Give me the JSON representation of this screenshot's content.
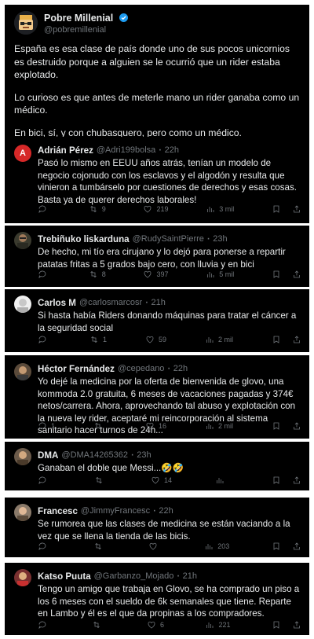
{
  "main_tweet": {
    "name": "Pobre Millenial",
    "handle": "@pobremillenial",
    "paragraphs": [
      "España es esa clase de país donde uno de sus pocos unicornios es destruido porque a alguien se le ocurrió que un rider estaba explotado.",
      "Lo curioso es que antes de meterle mano un rider ganaba como un médico.",
      "En bici, sí,  y con chubasquero, pero como un médico."
    ]
  },
  "replies": [
    {
      "name": "Adrián Pérez",
      "handle": "@Adri199bolsa",
      "time": "22h",
      "avatar_letter": "A",
      "avatar_color": "#d62828",
      "text": "Pasó lo mismo en EEUU años atrás, tenían un modelo de negocio cojonudo con los esclavos y el algodón y resulta que vinieron a tumbárselo por cuestiones de derechos y esas cosas. Basta ya de querer derechos laborales!",
      "replies": "",
      "retweets": "9",
      "likes": "219",
      "views": "3 mil"
    },
    {
      "name": "Trebiñuko liskarduna",
      "handle": "@RudySaintPierre",
      "time": "23h",
      "avatar_letter": "",
      "avatar_color": "#3a3a2e",
      "text": "De hecho, mi tío era cirujano y lo dejó para ponerse a repartir patatas fritas a 5 grados bajo cero, con lluvia y en bici",
      "replies": "",
      "retweets": "8",
      "likes": "397",
      "views": "5 mil"
    },
    {
      "name": "Carlos M",
      "handle": "@carlosmarcosr",
      "time": "21h",
      "avatar_letter": "",
      "avatar_color": "#f0f0f0",
      "text": "Si hasta había Riders donando máquinas para tratar el cáncer a la seguridad social",
      "replies": "",
      "retweets": "1",
      "likes": "59",
      "views": "2 mil"
    },
    {
      "name": "Héctor Fernández",
      "handle": "@cepedano",
      "time": "22h",
      "avatar_letter": "",
      "avatar_color": "#5a4a3a",
      "text": "Yo dejé la medicina por la oferta de bienvenida de glovo, una kommoda 2.0 gratuita, 6 meses de vacaciones pagadas y 374€ netos/carrera. Ahora, aprovechando tal abuso y explotación con la nueva ley rider, aceptaré mi reincorporación al sistema sanitario hacer turnos de 24h...",
      "replies": "1",
      "retweets": "",
      "likes": "16",
      "views": "2 mil"
    },
    {
      "name": "DMA",
      "handle": "@DMA14265362",
      "time": "23h",
      "avatar_letter": "",
      "avatar_color": "#6b5a4a",
      "text": "Ganaban el doble que Messi...🤣🤣",
      "replies": "",
      "retweets": "",
      "likes": "14",
      "views": ""
    },
    {
      "name": "Francesc",
      "handle": "@JimmyFrancesc",
      "time": "22h",
      "avatar_letter": "",
      "avatar_color": "#8a7a6a",
      "text": "Se rumorea que las clases de medicina se están vaciando a la vez que se llena la tienda de las bicis.",
      "replies": "",
      "retweets": "",
      "likes": "",
      "views": "203"
    },
    {
      "name": "Katso Puuta",
      "handle": "@Garbanzo_Mojado",
      "time": "21h",
      "avatar_letter": "",
      "avatar_color": "#7a3030",
      "text": "Tengo un amigo que trabaja en Glovo, se ha comprado un piso a los 6 meses con el sueldo de 6k semanales que tiene. Reparte en Lambo y él es el que da propinas a los compradores.",
      "replies": "",
      "retweets": "",
      "likes": "6",
      "views": "221"
    }
  ],
  "icons": {
    "verified": "verified-badge-icon",
    "reply": "reply-icon",
    "retweet": "retweet-icon",
    "like": "heart-icon",
    "views": "views-icon",
    "bookmark": "bookmark-icon",
    "share": "share-icon"
  },
  "colors": {
    "background": "#000000",
    "text": "#e7e9ea",
    "muted": "#71767b",
    "verified": "#1d9bf0"
  }
}
